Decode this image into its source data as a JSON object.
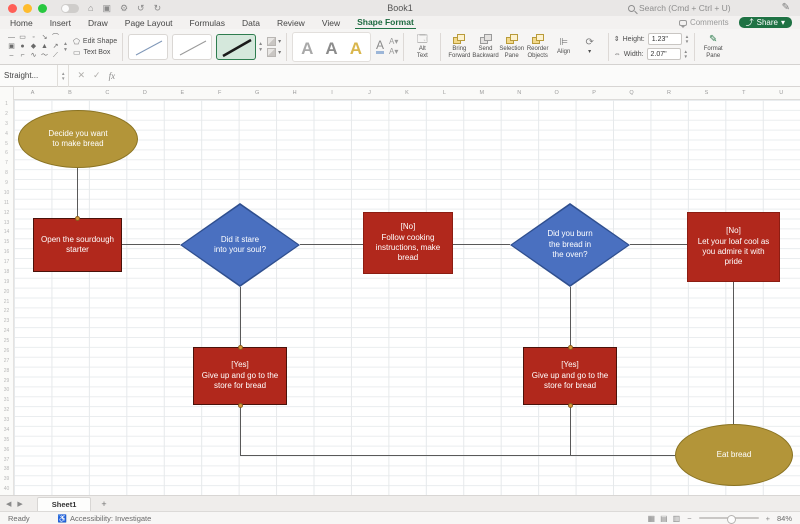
{
  "titlebar": {
    "title": "Book1",
    "search_label": "Search (Cmd + Ctrl + U)"
  },
  "menu": {
    "tabs": [
      "Home",
      "Insert",
      "Draw",
      "Page Layout",
      "Formulas",
      "Data",
      "Review",
      "View",
      "Shape Format"
    ],
    "active_tab": "Shape Format"
  },
  "actions": {
    "comments": "Comments",
    "share": "Share",
    "share_chevron": "▾"
  },
  "ribbon": {
    "edit_shape": "Edit Shape",
    "text_box": "Text Box",
    "wordart": [
      "A",
      "A",
      "A"
    ],
    "alt_text": "Alt\nText",
    "bring_forward": "Bring\nForward",
    "send_backward": "Send\nBackward",
    "selection_pane": "Selection\nPane",
    "reorder_objects": "Reorder\nObjects",
    "align": "Align",
    "height_label": "Height:",
    "height_value": "1.23\"",
    "width_label": "Width:",
    "width_value": "2.07\"",
    "format_pane": "Format\nPane"
  },
  "formula_bar": {
    "name_box": "Straight...",
    "cancel": "✕",
    "enter": "✓",
    "fx": "fx"
  },
  "grid": {
    "columns": [
      "A",
      "B",
      "C",
      "D",
      "E",
      "F",
      "G",
      "H",
      "I",
      "J",
      "K",
      "L",
      "M",
      "N",
      "O",
      "P",
      "Q",
      "R",
      "S",
      "T",
      "U"
    ],
    "row_count": 40
  },
  "flowchart": {
    "colors": {
      "terminator_fill": "#b39539",
      "terminator_border": "#8a7322",
      "process_fill": "#b1281c",
      "process_border": "#8c1d12",
      "decision_fill": "#4a70c0",
      "decision_border": "#2f4f8f",
      "connector": "#595959",
      "text": "#ffffff"
    },
    "nodes": [
      {
        "id": "start",
        "type": "terminator",
        "text": "Decide you want\nto make bread"
      },
      {
        "id": "open-starter",
        "type": "process",
        "text": "Open the sourdough\nstarter"
      },
      {
        "id": "stare-soul",
        "type": "decision",
        "text": "Did it stare\ninto your soul?"
      },
      {
        "id": "follow-instructions",
        "type": "process",
        "text": "[No]\nFollow cooking\ninstructions, make\nbread"
      },
      {
        "id": "burn-bread",
        "type": "decision",
        "text": "Did you burn\nthe bread in\nthe oven?"
      },
      {
        "id": "cool-loaf",
        "type": "process",
        "text": "[No]\nLet your loaf cool as\nyou admire it with\npride"
      },
      {
        "id": "store-bread-1",
        "type": "process",
        "text": "[Yes]\nGive up and go to the\nstore for bread"
      },
      {
        "id": "store-bread-2",
        "type": "process",
        "text": "[Yes]\nGive up and go to the\nstore for bread"
      },
      {
        "id": "end",
        "type": "terminator",
        "text": "Eat bread"
      }
    ]
  },
  "sheet_bar": {
    "active_tab": "Sheet1",
    "add": "+"
  },
  "status_bar": {
    "mode": "Ready",
    "accessibility": "Accessibility: Investigate",
    "zoom": "84%"
  }
}
